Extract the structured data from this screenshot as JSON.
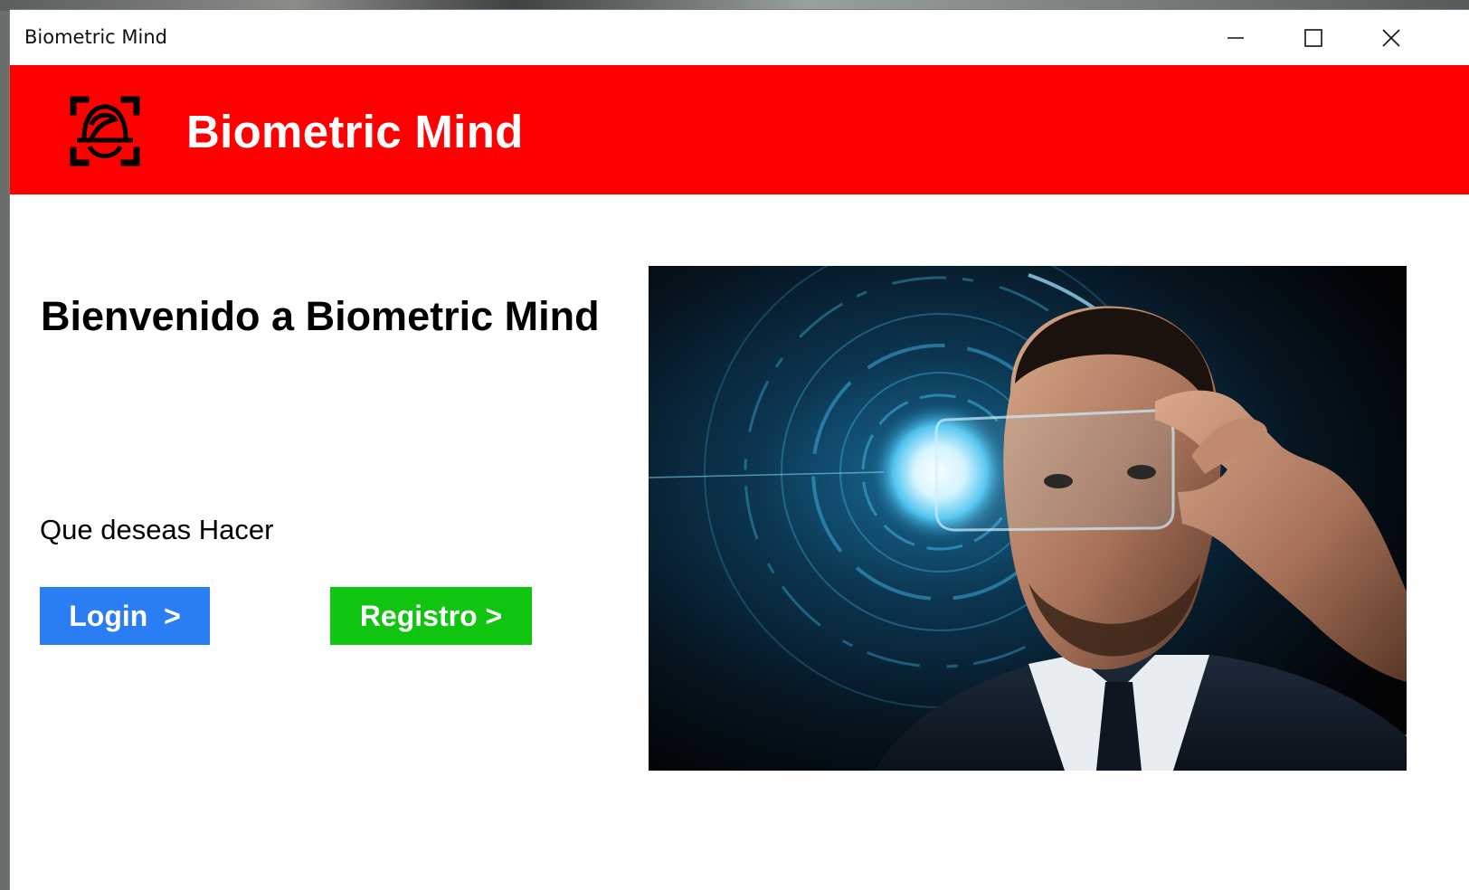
{
  "window": {
    "title": "Biometric Mind",
    "controls": {
      "minimize": "minimize-icon",
      "maximize": "maximize-icon",
      "close": "close-icon"
    }
  },
  "header": {
    "logo_icon": "face-scan-icon",
    "title": "Biometric Mind",
    "background": "#ff0000"
  },
  "main": {
    "welcome": "Bienvenido a Biometric Mind",
    "question": "Que deseas Hacer",
    "login_label": "Login  >",
    "registro_label": "Registro >",
    "login_color": "#2b7df3",
    "registro_color": "#10c510"
  },
  "hero_image": {
    "icon": "biometric-face-scan-photo"
  }
}
